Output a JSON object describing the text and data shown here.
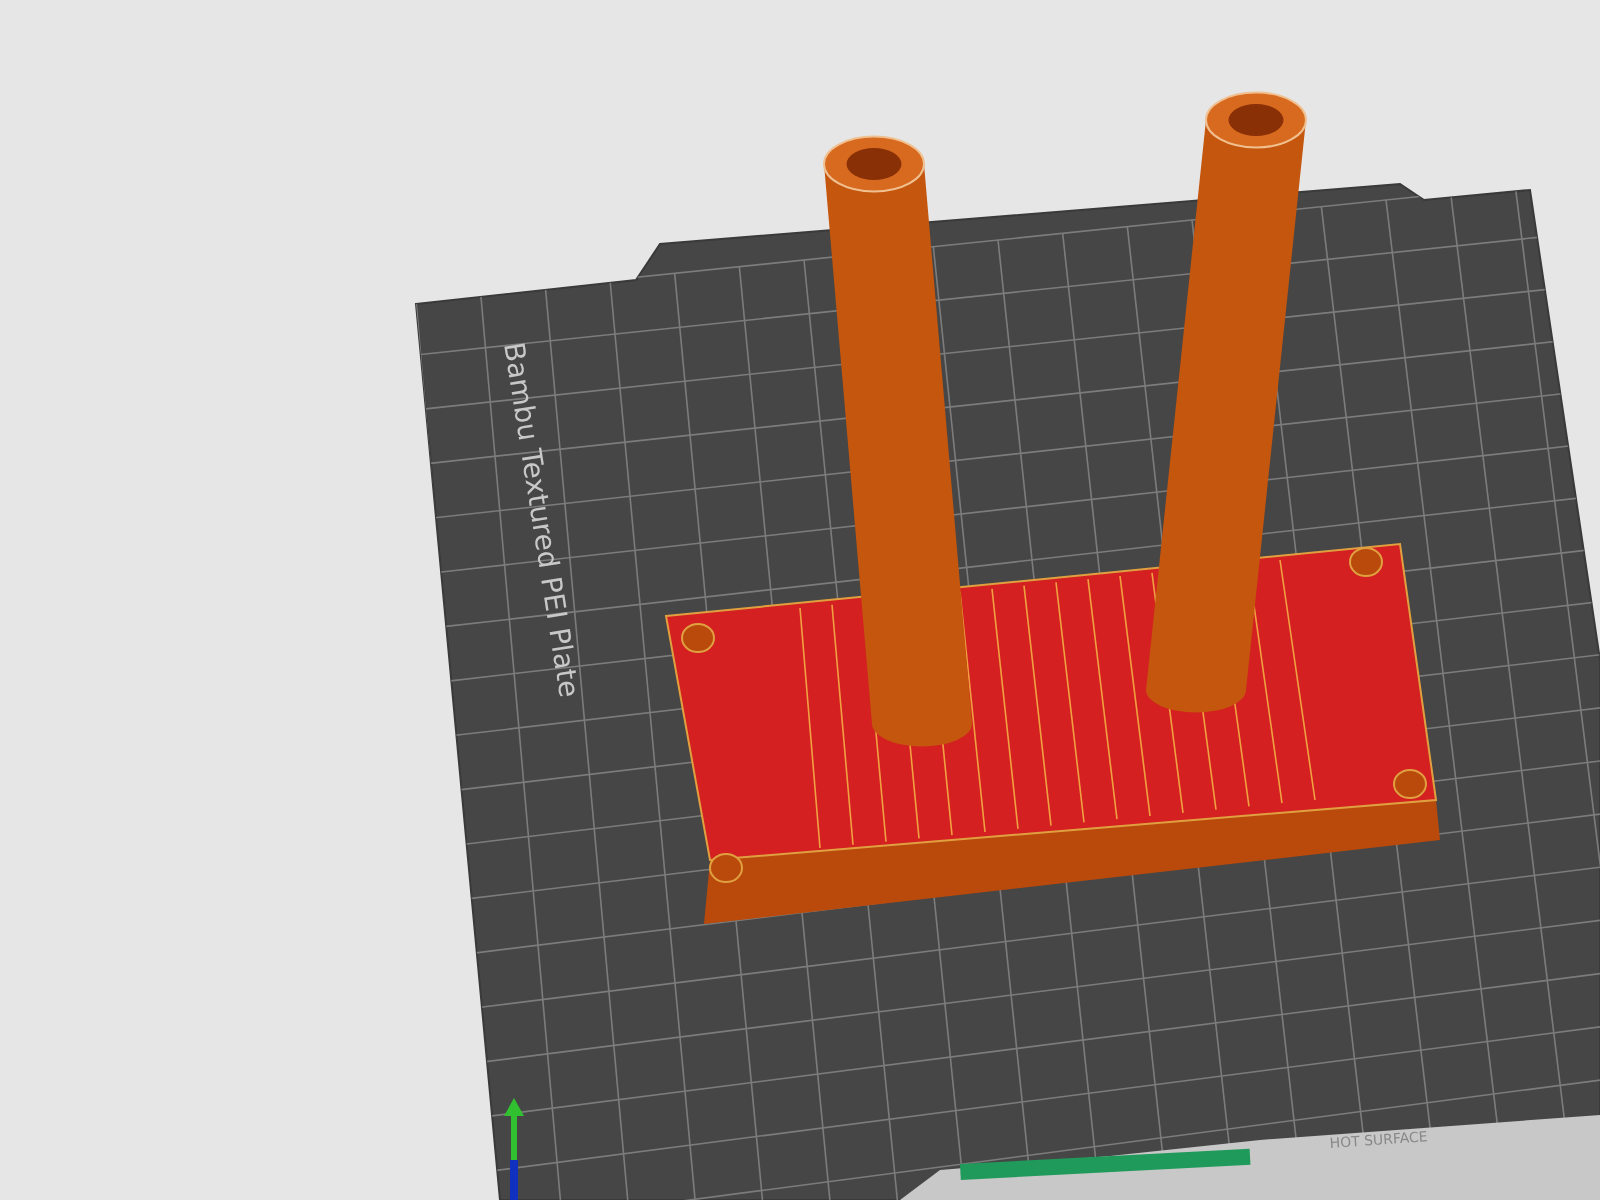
{
  "viewport": {
    "plate": {
      "label": "Bambu Textured PEI Plate",
      "warning": "HOT SURFACE"
    }
  }
}
